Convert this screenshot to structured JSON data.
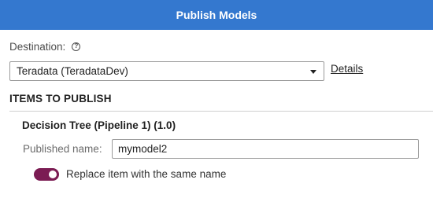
{
  "dialog": {
    "title": "Publish Models"
  },
  "destination": {
    "label": "Destination:",
    "help_icon": "question-circle-icon",
    "selected": "Teradata (TeradataDev)",
    "details_link": "Details"
  },
  "items_section": {
    "heading": "ITEMS TO PUBLISH",
    "items": [
      {
        "title": "Decision Tree (Pipeline 1) (1.0)",
        "published_name_label": "Published name:",
        "published_name_value": "mymodel2"
      }
    ]
  },
  "replace_toggle": {
    "label": "Replace item with the same name",
    "checked": true
  },
  "colors": {
    "titlebar": "#3478cf",
    "toggle_on": "#7b1c53"
  }
}
